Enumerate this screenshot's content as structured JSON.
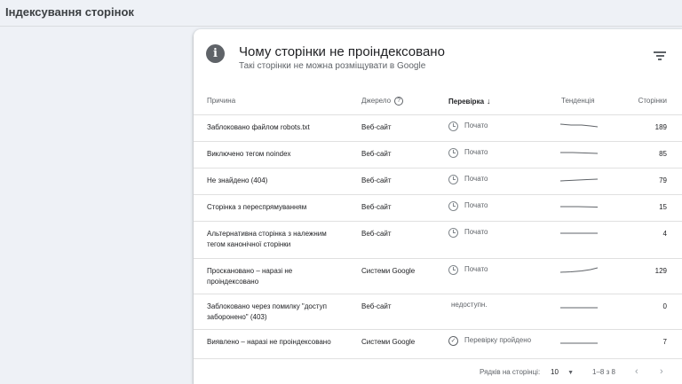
{
  "page": {
    "title": "Індексування сторінок"
  },
  "card": {
    "title": "Чому сторінки не проіндексовано",
    "subtitle": "Такі сторінки не можна розміщувати в Google",
    "info_icon": "info-icon",
    "filter_icon": "filter-icon"
  },
  "table": {
    "headers": {
      "reason": "Причина",
      "source": "Джерело",
      "check": "Перевірка",
      "trend": "Тенденція",
      "pages": "Сторінки"
    },
    "rows": [
      {
        "reason": "Заблоковано файлом robots.txt",
        "source": "Веб-сайт",
        "status": "Почато",
        "status_icon": "clock-icon",
        "count": "189"
      },
      {
        "reason": "Виключено тегом noindex",
        "source": "Веб-сайт",
        "status": "Почато",
        "status_icon": "clock-icon",
        "count": "85"
      },
      {
        "reason": "Не знайдено (404)",
        "source": "Веб-сайт",
        "status": "Почато",
        "status_icon": "clock-icon",
        "count": "79"
      },
      {
        "reason": "Сторінка з переспрямуванням",
        "source": "Веб-сайт",
        "status": "Почато",
        "status_icon": "clock-icon",
        "count": "15"
      },
      {
        "reason": "Альтернативна сторінка з належним тегом канонічної сторінки",
        "source": "Веб-сайт",
        "status": "Почато",
        "status_icon": "clock-icon",
        "count": "4"
      },
      {
        "reason": "Проскановано – наразі не проіндексовано",
        "source": "Системи Google",
        "status": "Почато",
        "status_icon": "clock-icon",
        "count": "129"
      },
      {
        "reason": "Заблоковано через помилку \"доступ заборонено\" (403)",
        "source": "Веб-сайт",
        "status": "недоступн.",
        "status_icon": "",
        "count": "0"
      },
      {
        "reason": "Виявлено – наразі не проіндексовано",
        "source": "Системи Google",
        "status": "Перевірку пройдено",
        "status_icon": "check-circle-icon",
        "count": "7"
      }
    ]
  },
  "pagination": {
    "rows_per_page_label": "Рядків на сторінці:",
    "rows_per_page_value": "10",
    "range": "1–8 з 8"
  },
  "colors": {
    "accent": "#5f6368",
    "divider": "#e0e0e0",
    "background": "#eef1f6"
  }
}
